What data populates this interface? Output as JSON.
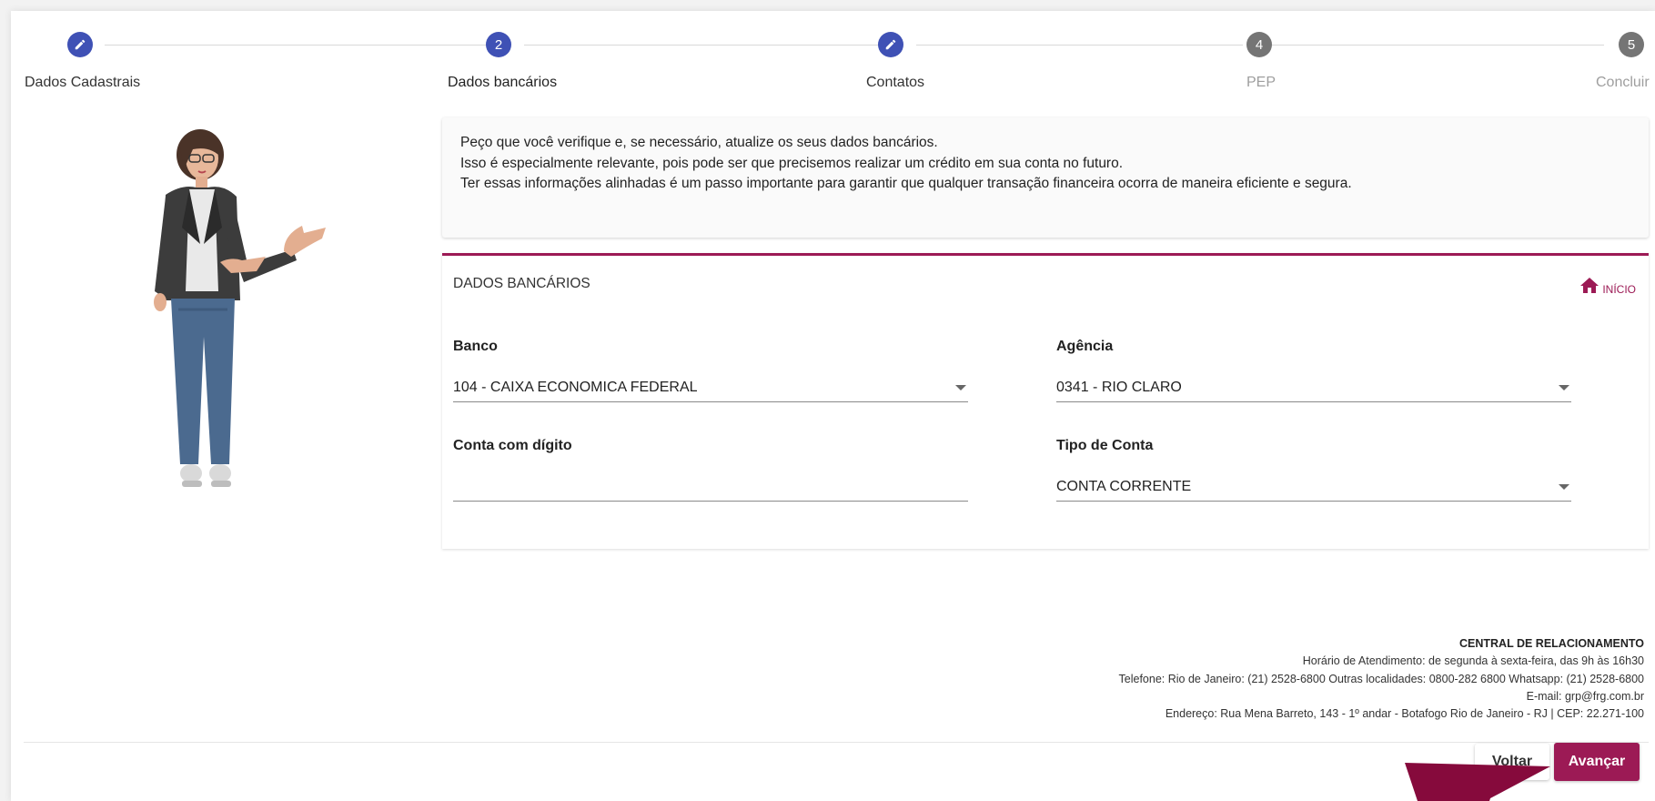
{
  "stepper": {
    "steps": [
      {
        "label": "Dados Cadastrais",
        "icon": "pencil-icon",
        "status": "done"
      },
      {
        "label": "Dados bancários",
        "number": "2",
        "status": "current"
      },
      {
        "label": "Contatos",
        "icon": "pencil-icon",
        "status": "done"
      },
      {
        "label": "PEP",
        "number": "4",
        "status": "pending"
      },
      {
        "label": "Concluir",
        "number": "5",
        "status": "pending"
      }
    ]
  },
  "info": {
    "lines": [
      "Peço que você verifique e, se necessário, atualize os seus dados bancários.",
      "Isso é especialmente relevante, pois pode ser que precisemos realizar um crédito em sua conta no futuro.",
      "Ter essas informações alinhadas é um passo importante para garantir que qualquer transação financeira ocorra de maneira eficiente e segura."
    ]
  },
  "bank_card": {
    "title": "DADOS BANCÁRIOS",
    "home_label": "INÍCIO",
    "home_icon": "home-icon",
    "fields": {
      "banco": {
        "label": "Banco",
        "value": "104 - CAIXA ECONOMICA FEDERAL"
      },
      "agencia": {
        "label": "Agência",
        "value": "0341 - RIO CLARO"
      },
      "conta": {
        "label": "Conta com dígito",
        "value": ""
      },
      "tipo": {
        "label": "Tipo de Conta",
        "value": "CONTA CORRENTE"
      }
    }
  },
  "footer": {
    "title": "CENTRAL DE RELACIONAMENTO",
    "hours": "Horário de Atendimento: de segunda à sexta-feira, das 9h às 16h30",
    "phone": "Telefone: Rio de Janeiro: (21) 2528-6800 Outras localidades: 0800-282 6800 Whatsapp: (21) 2528-6800",
    "email": "E-mail: grp@frg.com.br",
    "address": "Endereço: Rua Mena Barreto, 143 - 1º andar - Botafogo Rio de Janeiro - RJ | CEP: 22.271-100"
  },
  "actions": {
    "back_label": "Voltar",
    "next_label": "Avançar"
  },
  "colors": {
    "primary": "#9c1a55",
    "step_active": "#3f51b5",
    "step_inactive": "#757575"
  }
}
